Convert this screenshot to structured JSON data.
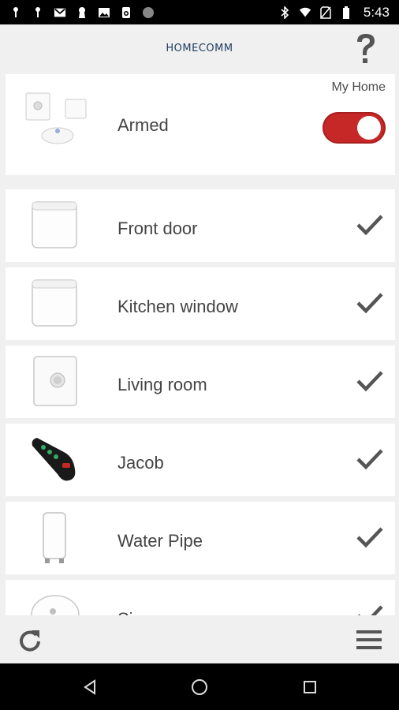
{
  "status_bar": {
    "time": "5:43",
    "left_icons": [
      "notification-icon",
      "notification-icon",
      "gmail-icon",
      "keyhole-icon",
      "image-icon",
      "lock-app-icon",
      "circle-icon"
    ],
    "right_icons": [
      "bluetooth-icon",
      "wifi-icon",
      "no-sim-icon",
      "battery-icon"
    ]
  },
  "header": {
    "title": "HOMECOMM",
    "help_icon": "question-mark-icon"
  },
  "arm_panel": {
    "home_name": "My Home",
    "status_label": "Armed",
    "toggle_on": true,
    "toggle_color": "#c62828"
  },
  "devices": [
    {
      "label": "Front door",
      "icon": "door-sensor-icon",
      "checked": true
    },
    {
      "label": "Kitchen window",
      "icon": "window-sensor-icon",
      "checked": true
    },
    {
      "label": "Living room",
      "icon": "motion-sensor-icon",
      "checked": true
    },
    {
      "label": "Jacob",
      "icon": "key-fob-icon",
      "checked": true
    },
    {
      "label": "Water Pipe",
      "icon": "water-sensor-icon",
      "checked": true
    },
    {
      "label": "Siren",
      "icon": "siren-icon",
      "checked": true
    }
  ],
  "bottom_bar": {
    "refresh_icon": "refresh-icon",
    "menu_icon": "hamburger-menu-icon"
  },
  "nav_bar": {
    "buttons": [
      "back-icon",
      "home-icon",
      "recents-icon"
    ]
  }
}
